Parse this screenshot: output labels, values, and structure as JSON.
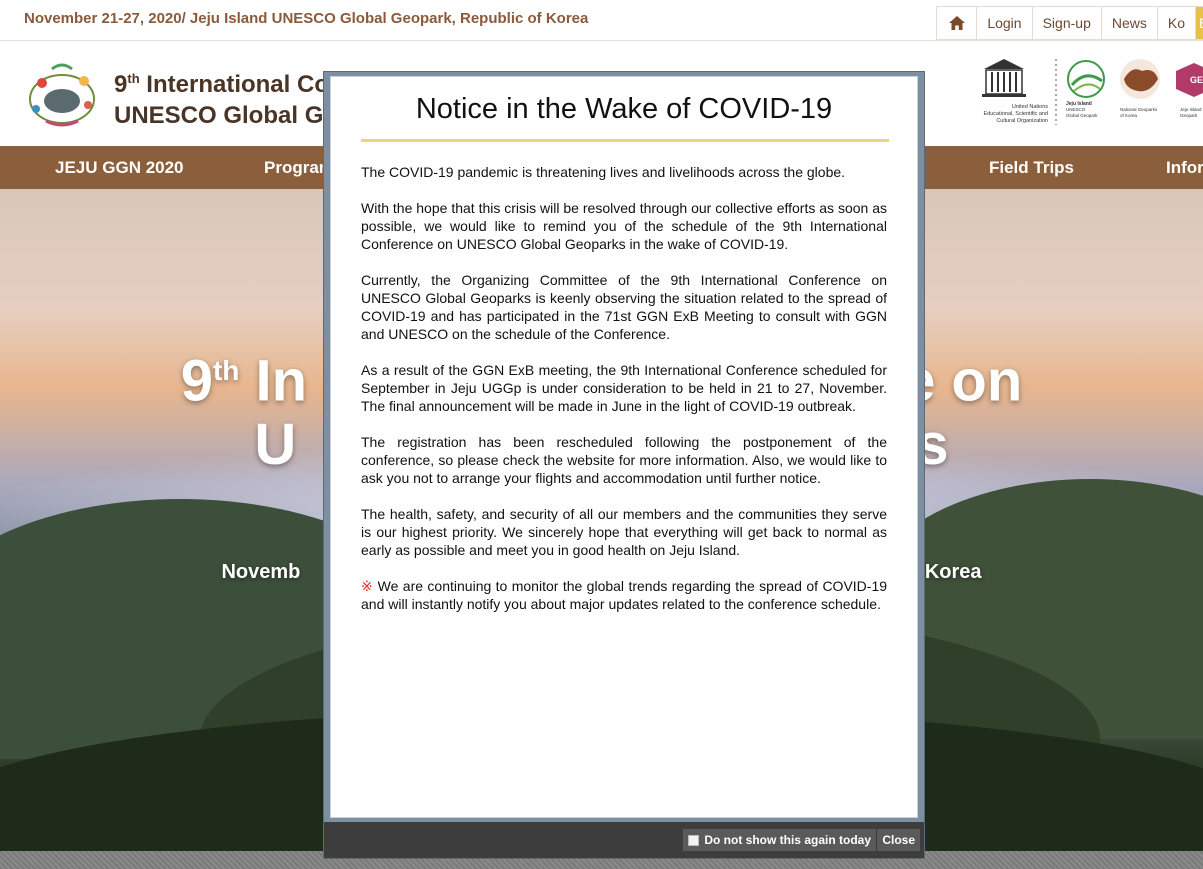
{
  "topbar": {
    "date_line": "November 21-27, 2020/ Jeju Island UNESCO Global Geopark, Republic of Korea",
    "links": [
      "Login",
      "Sign-up",
      "News",
      "Ko",
      "E"
    ],
    "home_icon": "home-icon"
  },
  "header": {
    "title_prefix": "9",
    "title_sup": "th",
    "title_line1_rest": " International Co",
    "title_line2": "UNESCO Global Ge",
    "partners": {
      "unesco": "United Nations Educational, Scientific and Cultural Organization",
      "jeju": "Jeju Island UNESCO Global Geopark",
      "ngk": "National Geoparks of Korea",
      "jeju_geo": "Jeju Island Geopark"
    }
  },
  "mainnav": {
    "items": [
      "JEJU GGN 2020",
      "Program",
      "Field Trips",
      "Infor"
    ]
  },
  "hero": {
    "title_prefix": "9",
    "title_sup": "th",
    "title_line1_left": " In",
    "title_line1_right": "e on",
    "title_line2_left": "U",
    "title_line2_right": "s",
    "subtitle_left": "Novemb",
    "subtitle_right": "of Korea"
  },
  "modal": {
    "title": "Notice in the Wake of COVID-19",
    "paragraphs": [
      "The COVID-19 pandemic is threatening lives and livelihoods across the globe.",
      "With the hope that this crisis will be resolved through our collective efforts as soon as possible, we would like to remind you of the schedule of the 9th International Conference on UNESCO Global Geoparks in the wake of COVID-19.",
      "Currently, the Organizing Committee of the 9th International Conference on UNESCO Global Geoparks is keenly observing the situation related to the spread of COVID-19 and has participated in the 71st GGN ExB Meeting to consult with GGN and UNESCO on the schedule of the Conference.",
      "As a result of the GGN ExB meeting, the 9th International Conference scheduled for September in Jeju UGGp is under consideration to be held in 21 to 27, November. The final announcement will be made in June in the light of COVID-19 outbreak.",
      "The registration has been rescheduled following the postponement of the conference, so please check the website for more information. Also, we would like to ask you not to arrange your flights and accommodation until further notice.",
      "The health, safety, and security of all our members and the communities they serve is our highest priority. We sincerely hope that everything will get back to normal as early as possible and meet you in good health on Jeju Island."
    ],
    "note_mark": "※",
    "note": "We are continuing to monitor the global trends regarding the spread of COVID-19 and will instantly notify you about major updates related to the conference schedule.",
    "dont_show_label": "Do not show this again today",
    "close_label": "Close"
  }
}
